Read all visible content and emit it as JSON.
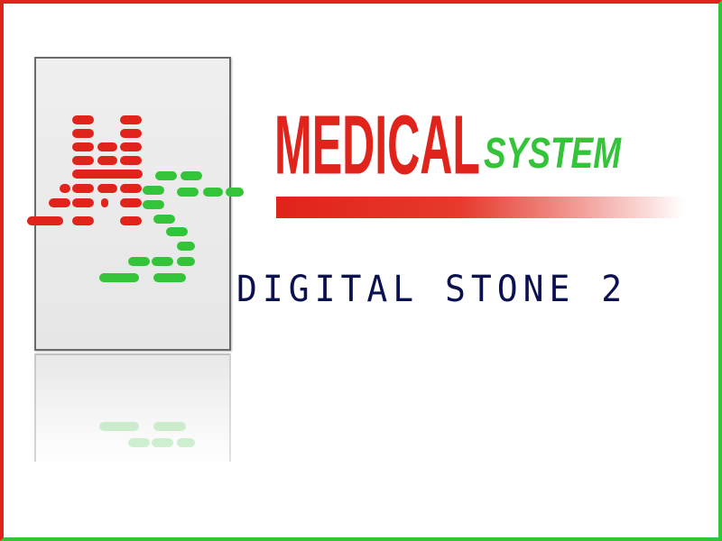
{
  "brand": {
    "word_main": "MEDICAL",
    "word_suffix": "SYSTEM",
    "product": "DIGITAL STONE 2"
  },
  "icons": {
    "logo": "ms-dash-logo-icon"
  },
  "colors": {
    "red": "#e0231b",
    "green": "#33c43a",
    "dark_navy": "#0b1050",
    "panel_gray": "#e8e8e8"
  }
}
